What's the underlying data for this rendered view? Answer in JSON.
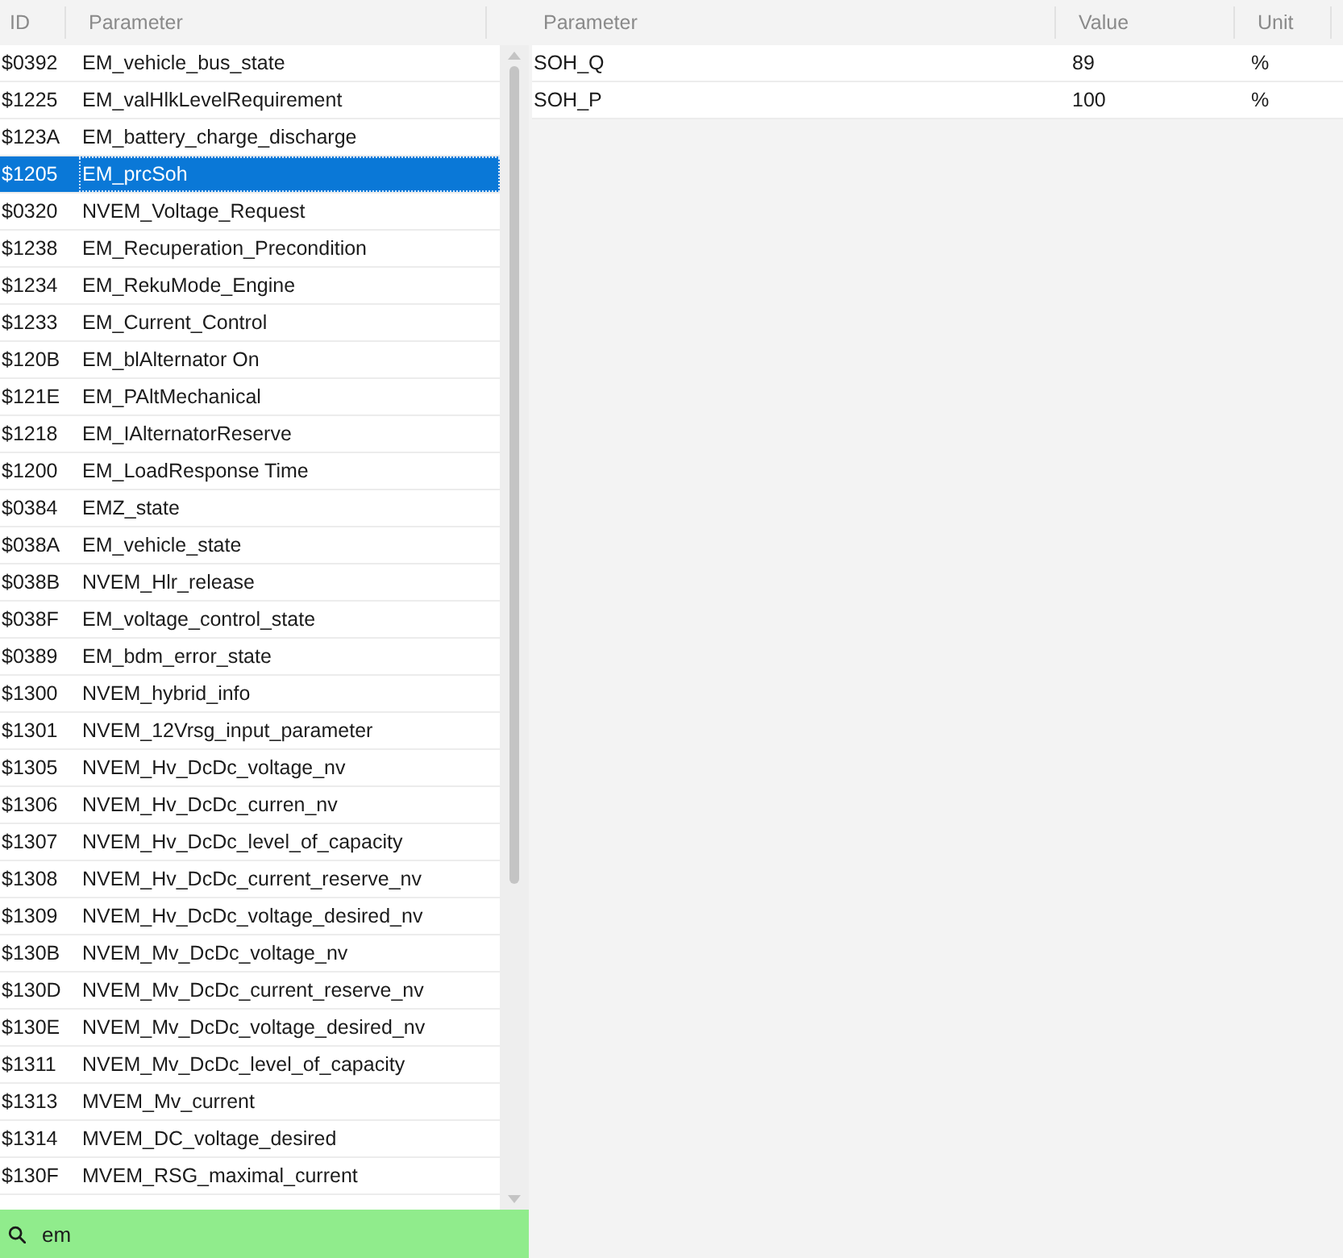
{
  "parameter_list": {
    "columns": [
      "ID",
      "Parameter"
    ],
    "rows": [
      {
        "id": "$0392",
        "parameter": "EM_vehicle_bus_state",
        "selected": false
      },
      {
        "id": "$1225",
        "parameter": "EM_valHlkLevelRequirement",
        "selected": false
      },
      {
        "id": "$123A",
        "parameter": "EM_battery_charge_discharge",
        "selected": false
      },
      {
        "id": "$1205",
        "parameter": "EM_prcSoh",
        "selected": true
      },
      {
        "id": "$0320",
        "parameter": "NVEM_Voltage_Request",
        "selected": false
      },
      {
        "id": "$1238",
        "parameter": "EM_Recuperation_Precondition",
        "selected": false
      },
      {
        "id": "$1234",
        "parameter": "EM_RekuMode_Engine",
        "selected": false
      },
      {
        "id": "$1233",
        "parameter": "EM_Current_Control",
        "selected": false
      },
      {
        "id": "$120B",
        "parameter": "EM_blAlternator On",
        "selected": false
      },
      {
        "id": "$121E",
        "parameter": "EM_PAltMechanical",
        "selected": false
      },
      {
        "id": "$1218",
        "parameter": "EM_IAlternatorReserve",
        "selected": false
      },
      {
        "id": "$1200",
        "parameter": "EM_LoadResponse Time",
        "selected": false
      },
      {
        "id": "$0384",
        "parameter": "EMZ_state",
        "selected": false
      },
      {
        "id": "$038A",
        "parameter": "EM_vehicle_state",
        "selected": false
      },
      {
        "id": "$038B",
        "parameter": "NVEM_Hlr_release",
        "selected": false
      },
      {
        "id": "$038F",
        "parameter": "EM_voltage_control_state",
        "selected": false
      },
      {
        "id": "$0389",
        "parameter": "EM_bdm_error_state",
        "selected": false
      },
      {
        "id": "$1300",
        "parameter": "NVEM_hybrid_info",
        "selected": false
      },
      {
        "id": "$1301",
        "parameter": "NVEM_12Vrsg_input_parameter",
        "selected": false
      },
      {
        "id": "$1305",
        "parameter": "NVEM_Hv_DcDc_voltage_nv",
        "selected": false
      },
      {
        "id": "$1306",
        "parameter": "NVEM_Hv_DcDc_curren_nv",
        "selected": false
      },
      {
        "id": "$1307",
        "parameter": "NVEM_Hv_DcDc_level_of_capacity",
        "selected": false
      },
      {
        "id": "$1308",
        "parameter": "NVEM_Hv_DcDc_current_reserve_nv",
        "selected": false
      },
      {
        "id": "$1309",
        "parameter": "NVEM_Hv_DcDc_voltage_desired_nv",
        "selected": false
      },
      {
        "id": "$130B",
        "parameter": "NVEM_Mv_DcDc_voltage_nv",
        "selected": false
      },
      {
        "id": "$130D",
        "parameter": "NVEM_Mv_DcDc_current_reserve_nv",
        "selected": false
      },
      {
        "id": "$130E",
        "parameter": "NVEM_Mv_DcDc_voltage_desired_nv",
        "selected": false
      },
      {
        "id": "$1311",
        "parameter": "NVEM_Mv_DcDc_level_of_capacity",
        "selected": false
      },
      {
        "id": "$1313",
        "parameter": "MVEM_Mv_current",
        "selected": false
      },
      {
        "id": "$1314",
        "parameter": "MVEM_DC_voltage_desired",
        "selected": false
      },
      {
        "id": "$130F",
        "parameter": "MVEM_RSG_maximal_current",
        "selected": false
      }
    ]
  },
  "search": {
    "value": "em"
  },
  "values_table": {
    "columns": [
      "Parameter",
      "Value",
      "Unit"
    ],
    "rows": [
      {
        "parameter": "SOH_Q",
        "value": "89",
        "unit": "%"
      },
      {
        "parameter": "SOH_P",
        "value": "100",
        "unit": "%"
      }
    ]
  }
}
